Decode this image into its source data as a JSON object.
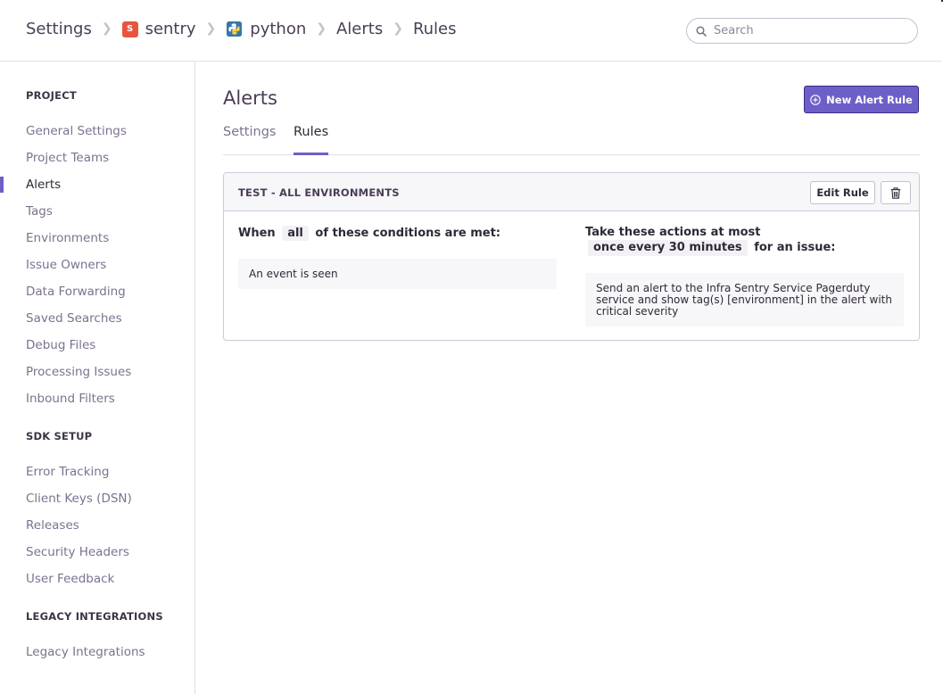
{
  "header": {
    "breadcrumbs": [
      "Settings",
      "sentry",
      "python",
      "Alerts",
      "Rules"
    ],
    "org_badge": "S",
    "search_placeholder": "Search"
  },
  "sidebar": {
    "sections": [
      {
        "title": "PROJECT",
        "items": [
          "General Settings",
          "Project Teams",
          "Alerts",
          "Tags",
          "Environments",
          "Issue Owners",
          "Data Forwarding",
          "Saved Searches",
          "Debug Files",
          "Processing Issues",
          "Inbound Filters"
        ]
      },
      {
        "title": "SDK SETUP",
        "items": [
          "Error Tracking",
          "Client Keys (DSN)",
          "Releases",
          "Security Headers",
          "User Feedback"
        ]
      },
      {
        "title": "LEGACY INTEGRATIONS",
        "items": [
          "Legacy Integrations"
        ]
      }
    ],
    "active_item": "Alerts"
  },
  "main": {
    "title": "Alerts",
    "new_rule_label": "New Alert Rule",
    "tabs": [
      {
        "label": "Settings",
        "active": false
      },
      {
        "label": "Rules",
        "active": true
      }
    ],
    "rule": {
      "name": "TEST - ALL ENVIRONMENTS",
      "edit_label": "Edit Rule",
      "conditions_prefix": "When",
      "conditions_match": "all",
      "conditions_suffix": "of these conditions are met:",
      "condition": "An event is seen",
      "actions_prefix": "Take these actions at most",
      "actions_frequency": "once every 30 minutes",
      "actions_suffix": "for an issue:",
      "action": "Send an alert to the Infra Sentry Service Pagerduty service and show tag(s) [environment] in the alert with critical severity"
    }
  },
  "colors": {
    "accent": "#6c5fc7",
    "org_badge": "#e8553f",
    "text_dark": "#2f2936",
    "text_muted": "#7d7190",
    "border": "#e2dee6"
  },
  "icons": [
    "chevron-right-icon",
    "python-icon",
    "search-icon",
    "add-circle-icon",
    "trash-icon"
  ]
}
